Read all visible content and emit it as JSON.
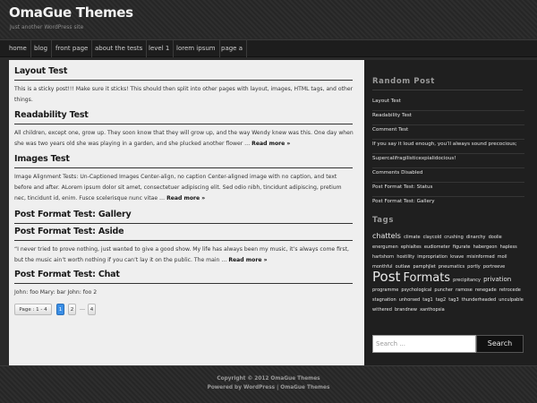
{
  "header": {
    "title": "OmaGue Themes",
    "tagline": "Just another WordPress site"
  },
  "nav": {
    "items": [
      "home",
      "blog",
      "front page",
      "about the tests",
      "level 1",
      "lorem ipsum",
      "page a"
    ]
  },
  "posts": [
    {
      "title": "Layout Test",
      "excerpt": "This is a sticky post!!! Make sure it sticks! This should then split into other pages with layout, images, HTML tags, and other things.",
      "read_more": ""
    },
    {
      "title": "Readability Test",
      "excerpt": "All children, except one, grow up. They soon know that they will grow up, and the way Wendy knew was this. One day when she was two years old she was playing in a garden, and she plucked another flower …",
      "read_more": "Read more »"
    },
    {
      "title": "Images Test",
      "excerpt": "Image Alignment Tests: Un-Captioned Images Center-align, no caption Center-aligned image with no caption, and text before and after. ALorem ipsum dolor sit amet, consectetuer adipiscing elit. Sed odio nibh, tincidunt adipiscing, pretium nec, tincidunt id, enim. Fusce scelerisque nunc vitae …",
      "read_more": "Read more »"
    },
    {
      "title": "Post Format Test: Gallery",
      "excerpt": "",
      "read_more": ""
    },
    {
      "title": "Post Format Test: Aside",
      "excerpt": "“I never tried to prove nothing, just wanted to give a good show. My life has always been my music, it’s always come first, but the music ain’t worth nothing if you can’t lay it on the public. The main …",
      "read_more": "Read more »"
    },
    {
      "title": "Post Format Test: Chat",
      "excerpt": "John: foo Mary: bar John: foo 2",
      "read_more": ""
    }
  ],
  "pagination": {
    "label": "Page : 1 - 4",
    "pages": [
      "1",
      "2",
      "4"
    ],
    "current": "1",
    "dots": "…"
  },
  "sidebar": {
    "random_post": {
      "title": "Random Post",
      "items": [
        "Layout Test",
        "Readability Test",
        "Comment Test",
        "If you say it loud enough, you’ll always sound precocious;",
        "Supercalifragilisticexpialidocious!",
        "Comments Disabled",
        "Post Format Test: Status",
        "Post Format Test: Gallery"
      ]
    },
    "tags": {
      "title": "Tags",
      "cloud": [
        {
          "label": "chattels",
          "size": "large"
        },
        {
          "label": "climate",
          "size": "small"
        },
        {
          "label": "claycold",
          "size": "small"
        },
        {
          "label": "crushing",
          "size": "small"
        },
        {
          "label": "dinarchy",
          "size": "small"
        },
        {
          "label": "doolie",
          "size": "small"
        },
        {
          "label": "energumen",
          "size": "small"
        },
        {
          "label": "ephialtes",
          "size": "small"
        },
        {
          "label": "eudiometer",
          "size": "small"
        },
        {
          "label": "figurate",
          "size": "small"
        },
        {
          "label": "habergeon",
          "size": "small"
        },
        {
          "label": "hapless",
          "size": "small"
        },
        {
          "label": "hartshorn",
          "size": "small"
        },
        {
          "label": "hostility",
          "size": "small"
        },
        {
          "label": "impropriation",
          "size": "small"
        },
        {
          "label": "knave",
          "size": "small"
        },
        {
          "label": "misinformed",
          "size": "small"
        },
        {
          "label": "moil",
          "size": "small"
        },
        {
          "label": "monthful",
          "size": "small"
        },
        {
          "label": "outlaw",
          "size": "small"
        },
        {
          "label": "pamphjlet",
          "size": "small"
        },
        {
          "label": "pneumatics",
          "size": "small"
        },
        {
          "label": "portly",
          "size": "small"
        },
        {
          "label": "portreeve",
          "size": "small"
        },
        {
          "label": "Post",
          "size": "xxl"
        },
        {
          "label": "Formats",
          "size": "xl"
        },
        {
          "label": "precipitancy",
          "size": "small"
        },
        {
          "label": "privation",
          "size": "medium"
        },
        {
          "label": "programme",
          "size": "small"
        },
        {
          "label": "psychological",
          "size": "small"
        },
        {
          "label": "puncher",
          "size": "small"
        },
        {
          "label": "ramose",
          "size": "small"
        },
        {
          "label": "renegade",
          "size": "small"
        },
        {
          "label": "retrocede",
          "size": "small"
        },
        {
          "label": "stagnation",
          "size": "small"
        },
        {
          "label": "unhorsed",
          "size": "small"
        },
        {
          "label": "tag1",
          "size": "small"
        },
        {
          "label": "tag2",
          "size": "small"
        },
        {
          "label": "tag3",
          "size": "small"
        },
        {
          "label": "thunderheaded",
          "size": "small"
        },
        {
          "label": "unculpable",
          "size": "small"
        },
        {
          "label": "withered",
          "size": "small"
        },
        {
          "label": "brandnew",
          "size": "small"
        },
        {
          "label": "xanthopsia",
          "size": "small"
        }
      ]
    },
    "search": {
      "placeholder": "Search ...",
      "button_label": "Search"
    }
  },
  "footer": {
    "copyright": "Copyright © 2012 OmaGue Themes",
    "powered": "Powered by WordPress | OmaGue Themes"
  }
}
